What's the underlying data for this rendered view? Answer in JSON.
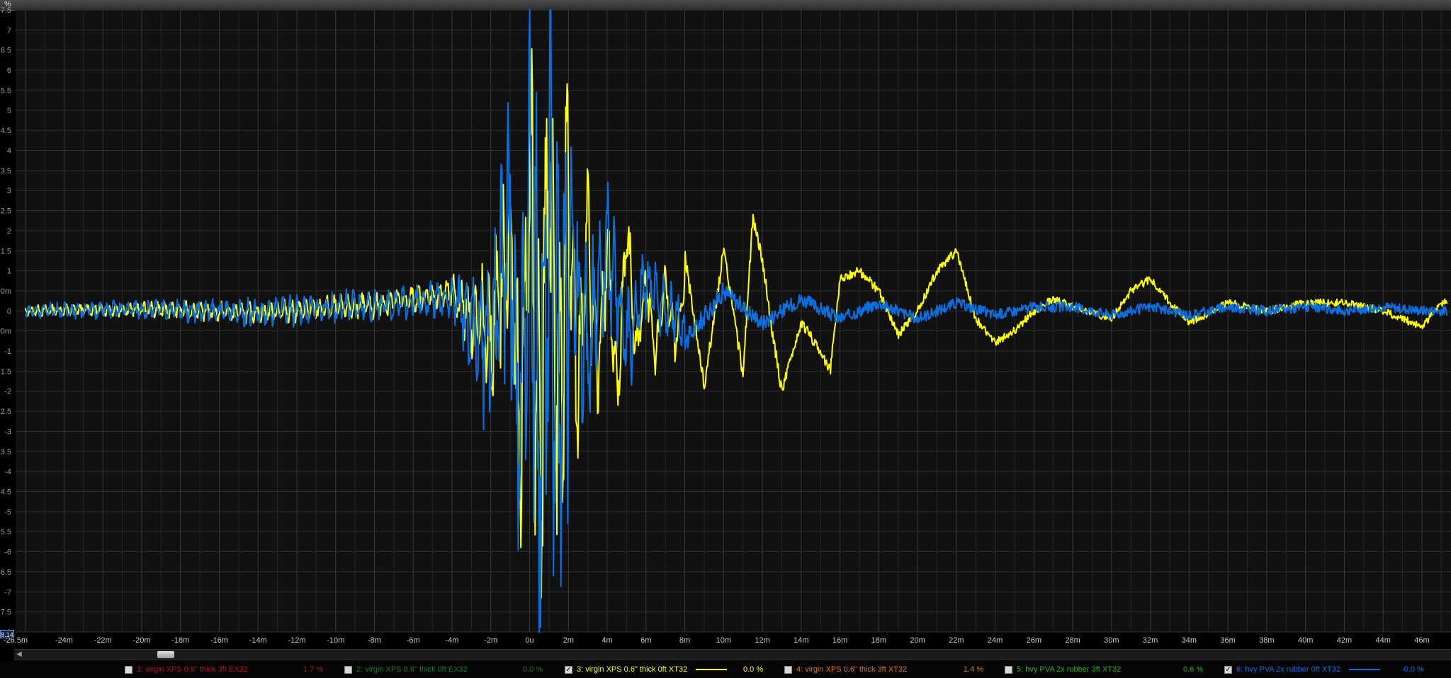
{
  "unit_label": "%",
  "cursor_readout": "8.14",
  "colors": {
    "background": "#111111",
    "grid": "#2f2f2f",
    "yellow": "#ffff00",
    "blue": "#0a6fe0"
  },
  "chart_data": {
    "type": "line",
    "title": "",
    "xlabel": "",
    "ylabel": "%",
    "xlim": [
      -26.5,
      47.5
    ],
    "ylim": [
      -8,
      7.5
    ],
    "grid": true,
    "legend_placement": "bottom",
    "y_ticks": [
      "7.5",
      "7",
      "6.5",
      "6",
      "5.5",
      "5",
      "4.5",
      "4",
      "3.5",
      "3",
      "2.5",
      "2",
      "1.5",
      "1",
      "500m",
      "0",
      "-500m",
      "-1",
      "-1.5",
      "-2",
      "-2.5",
      "-3",
      "-3.5",
      "-4",
      "-4.5",
      "-5",
      "-5.5",
      "-6",
      "-6.5",
      "-7",
      "-7.5",
      "-8"
    ],
    "x_ticks": [
      "-26.5m",
      "-24m",
      "-22m",
      "-20m",
      "-18m",
      "-16m",
      "-14m",
      "-12m",
      "-10m",
      "-8m",
      "-6m",
      "-4m",
      "-2m",
      "0u",
      "2m",
      "4m",
      "6m",
      "8m",
      "10m",
      "12m",
      "14m",
      "16m",
      "18m",
      "20m",
      "22m",
      "24m",
      "26m",
      "28m",
      "30m",
      "32m",
      "34m",
      "36m",
      "38m",
      "40m",
      "42m",
      "44m",
      "46m"
    ],
    "series": [
      {
        "name": "3: virgin XPS 0.6\" thick 0ft XT32",
        "color": "#ffff00",
        "x": [
          -26,
          -20,
          -14,
          -8,
          -4,
          -2,
          -1,
          -0.5,
          0,
          0.5,
          1,
          1.5,
          2,
          2.5,
          3,
          3.5,
          4,
          4.5,
          5,
          5.5,
          6,
          6.5,
          7,
          7.5,
          8,
          9,
          10,
          11,
          11.5,
          12,
          12.5,
          13,
          14,
          15,
          15.5,
          16,
          17,
          18,
          19,
          20,
          21,
          22,
          23,
          24,
          25,
          26,
          27,
          28,
          30,
          31,
          32,
          33,
          34,
          36,
          38,
          40,
          42,
          44,
          46,
          47
        ],
        "values": [
          0,
          0.1,
          -0.1,
          0.3,
          1.0,
          -1.5,
          3.5,
          -7.8,
          7.5,
          -7.5,
          7.5,
          -5.5,
          4.6,
          -4.2,
          4.5,
          -3.5,
          3.8,
          -5.5,
          4.8,
          -2.5,
          2.0,
          -2.9,
          1.5,
          -1.8,
          1.4,
          -1.9,
          1.5,
          -1.6,
          2.3,
          1.3,
          -0.5,
          -2.0,
          -0.3,
          -1.0,
          -1.5,
          0.8,
          1.0,
          0.5,
          -0.6,
          0.0,
          1.0,
          1.5,
          -0.2,
          -0.8,
          -0.5,
          0.0,
          0.3,
          0.1,
          -0.2,
          0.5,
          0.8,
          0.2,
          -0.3,
          0.2,
          0.0,
          0.2,
          0.2,
          0.0,
          -0.4,
          0.2
        ]
      },
      {
        "name": "6: hvy PVA 2x rubber 0ft XT32",
        "color": "#0a6fe0",
        "x": [
          -26,
          -20,
          -14,
          -8,
          -4,
          -2,
          -1,
          -0.5,
          0,
          0.5,
          1,
          1.5,
          2,
          3,
          4,
          5,
          6,
          8,
          10,
          12,
          14,
          16,
          18,
          20,
          22,
          24,
          26,
          28,
          30,
          32,
          34,
          36,
          38,
          40,
          42,
          44,
          46,
          47
        ],
        "values": [
          0,
          0.1,
          -0.1,
          0.3,
          0.8,
          -2.0,
          4.5,
          -7.8,
          7.5,
          -7.5,
          6.5,
          -7.0,
          4.5,
          -3.0,
          3.5,
          -2.0,
          1.5,
          -0.8,
          0.5,
          -0.3,
          0.3,
          -0.2,
          0.2,
          -0.2,
          0.2,
          -0.1,
          0.1,
          0.1,
          -0.1,
          0.1,
          -0.1,
          0.1,
          0.0,
          0.1,
          0.0,
          0.1,
          0.0,
          0.0
        ]
      }
    ]
  },
  "legend": [
    {
      "label": "1: virgin XPS 0.6\" thick 3ft EX32",
      "value": "1.7 %",
      "checked": false,
      "color": "#b01818"
    },
    {
      "label": "2: virgin XPS 0.6\" thick 0ft EX32",
      "value": "0.0 %",
      "checked": false,
      "color": "#1a7a2a"
    },
    {
      "label": "3: virgin XPS 0.6\" thick 0ft XT32",
      "value": "0.0 %",
      "checked": true,
      "color": "#ffff00"
    },
    {
      "label": "4: virgin XPS 0.6\" thick 3ft XT32",
      "value": "1.4 %",
      "checked": false,
      "color": "#e07810"
    },
    {
      "label": "5: hvy PVA 2x rubber 3ft XT32",
      "value": "0.6 %",
      "checked": false,
      "color": "#22b022"
    },
    {
      "label": "6: hvy PVA 2x rubber 0ft XT32",
      "value": "-0.0 %",
      "checked": true,
      "color": "#0a6fe0"
    }
  ]
}
